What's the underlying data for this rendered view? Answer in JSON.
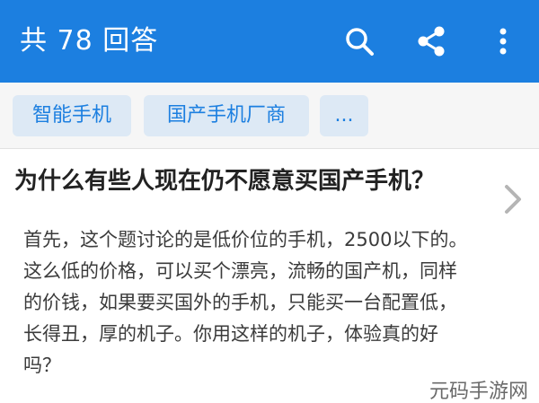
{
  "appbar": {
    "title": "共 78 回答",
    "icons": [
      "search-icon",
      "share-icon",
      "more-vert-icon"
    ],
    "color": "#1c7fe0"
  },
  "tags": [
    "智能手机",
    "国产手机厂商",
    "..."
  ],
  "question": {
    "title": "为什么有些人现在仍不愿意买国产手机？"
  },
  "answer": {
    "lines": [
      "首先，这个题讨论的是低价位的手机，2500以下的。",
      "这么低的价格，可以买个漂亮，流畅的国产机，同样",
      "的价钱，如果要买国外的手机，只能买一台配置低，",
      "长得丑，厚的机子。你用这样的机子，体验真的好",
      "吗？"
    ]
  },
  "watermark": "元码手游网"
}
